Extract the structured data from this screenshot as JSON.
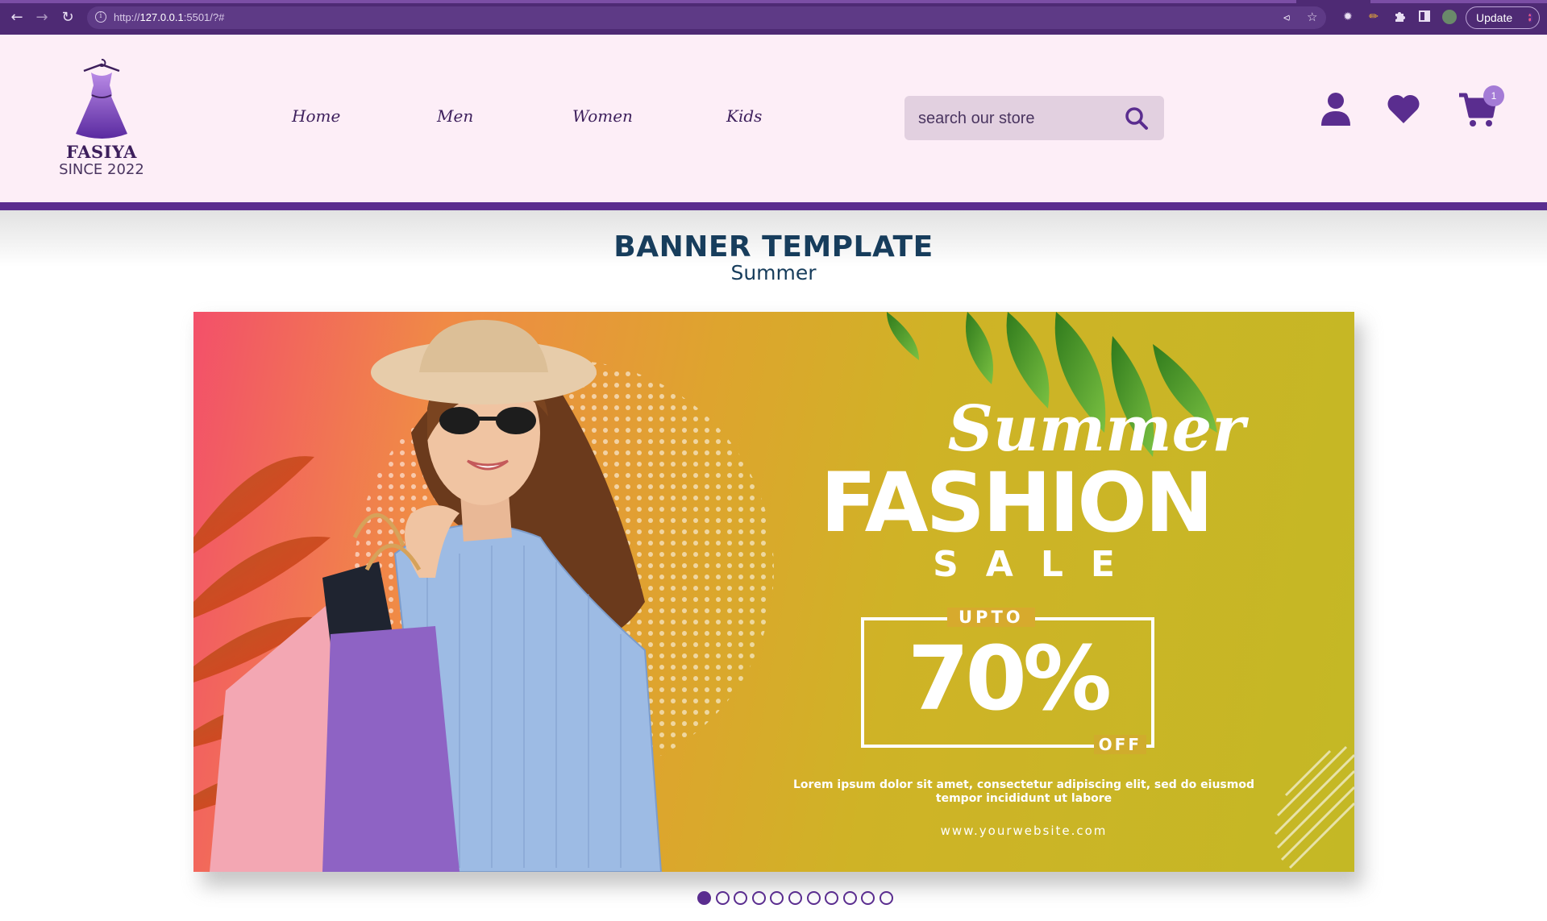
{
  "browser": {
    "url_prefix": "http://",
    "url_host": "127.0.0.1",
    "url_rest": ":5501/?#",
    "update_label": "Update",
    "icons": [
      "back-icon",
      "forward-icon",
      "reload-icon",
      "site-info-icon",
      "share-icon",
      "bookmark-star-icon",
      "extension-icon",
      "pen-extension-icon",
      "puzzle-icon",
      "side-panel-icon",
      "profile-avatar"
    ]
  },
  "header": {
    "brand": "FASIYA",
    "since": "SINCE 2022",
    "nav": [
      "Home",
      "Men",
      "Women",
      "Kids"
    ],
    "search_placeholder": "search our store",
    "cart_count": "1",
    "colors": {
      "header_bg": "#fdeef7",
      "accent": "#5a2d8f",
      "search_bg": "#e2d0e0"
    }
  },
  "banner": {
    "title": "BANNER TEMPLATE",
    "subtitle": "Summer",
    "slide": {
      "script_word": "Summer",
      "headline": "FASHION",
      "sale": "SALE",
      "upto": "UPTO",
      "percent": "70%",
      "off": "OFF",
      "lorem": "Lorem ipsum dolor sit amet, consectetur adipiscing elit, sed do eiusmod tempor incididunt ut labore",
      "website": "www.yourwebsite.com"
    },
    "dot_count": 11,
    "active_dot": 0
  }
}
